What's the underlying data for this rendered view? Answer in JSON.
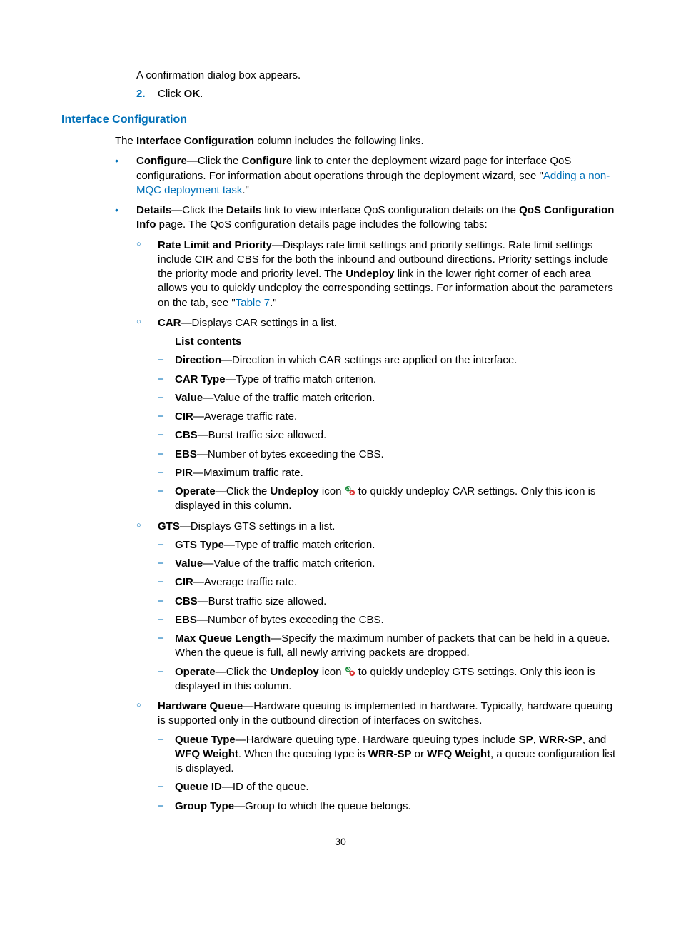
{
  "intro": {
    "confirm": "A confirmation dialog box appears.",
    "step2_prefix": "Click ",
    "step2_bold": "OK",
    "step2_suffix": "."
  },
  "heading": "Interface Configuration",
  "lead_prefix": "The ",
  "lead_bold": "Interface Configuration",
  "lead_suffix": " column includes the following links.",
  "configure": {
    "bold1": "Configure",
    "t1": "—Click the ",
    "bold2": "Configure",
    "t2": " link to enter the deployment wizard page for interface QoS configurations. For information about operations through the deployment wizard, see \"",
    "link": "Adding a non-MQC deployment task",
    "t3": ".\""
  },
  "details": {
    "bold1": "Details",
    "t1": "—Click the ",
    "bold2": "Details",
    "t2": " link to view interface QoS configuration details on the ",
    "bold3": "QoS Configuration Info",
    "t3": " page. The QoS configuration details page includes the following tabs:"
  },
  "rateLimit": {
    "bold": "Rate Limit and Priority",
    "t1": "—Displays rate limit settings and priority settings. Rate limit settings include CIR and CBS for the both the inbound and outbound directions. Priority settings include the priority mode and priority level. The ",
    "bold2": "Undeploy",
    "t2": " link in the lower right corner of each area allows you to quickly undeploy the corresponding settings. For information about the parameters on the tab, see \"",
    "link": "Table 7",
    "t3": ".\""
  },
  "car": {
    "bold": "CAR",
    "t": "—Displays CAR settings in a list.",
    "listHeading": "List contents",
    "items": {
      "direction": {
        "b": "Direction",
        "t": "—Direction in which CAR settings are applied on the interface."
      },
      "carType": {
        "b": "CAR Type",
        "t": "—Type of traffic match criterion."
      },
      "value": {
        "b": "Value",
        "t": "—Value of the traffic match criterion."
      },
      "cir": {
        "b": "CIR",
        "t": "—Average traffic rate."
      },
      "cbs": {
        "b": "CBS",
        "t": "—Burst traffic size allowed."
      },
      "ebs": {
        "b": "EBS",
        "t": "—Number of bytes exceeding the CBS."
      },
      "pir": {
        "b": "PIR",
        "t": "—Maximum traffic rate."
      },
      "operate": {
        "b": "Operate",
        "t1": "—Click the ",
        "b2": "Undeploy",
        "t2": " icon ",
        "t3": " to quickly undeploy CAR settings. Only this icon is displayed in this column."
      }
    }
  },
  "gts": {
    "bold": "GTS",
    "t": "—Displays GTS settings in a list.",
    "items": {
      "gtsType": {
        "b": "GTS Type",
        "t": "—Type of traffic match criterion."
      },
      "value": {
        "b": "Value",
        "t": "—Value of the traffic match criterion."
      },
      "cir": {
        "b": "CIR",
        "t": "—Average traffic rate."
      },
      "cbs": {
        "b": "CBS",
        "t": "—Burst traffic size allowed."
      },
      "ebs": {
        "b": "EBS",
        "t": "—Number of bytes exceeding the CBS."
      },
      "maxq": {
        "b": "Max Queue Length",
        "t": "—Specify the maximum number of packets that can be held in a queue. When the queue is full, all newly arriving packets are dropped."
      },
      "operate": {
        "b": "Operate",
        "t1": "—Click the ",
        "b2": "Undeploy",
        "t2": " icon ",
        "t3": " to quickly undeploy GTS settings. Only this icon is displayed in this column."
      }
    }
  },
  "hq": {
    "bold": "Hardware Queue",
    "t": "—Hardware queuing is implemented in hardware. Typically, hardware queuing is supported only in the outbound direction of interfaces on switches.",
    "items": {
      "qtype": {
        "b": "Queue Type",
        "t1": "—Hardware queuing type. Hardware queuing types include ",
        "b2": "SP",
        "t2": ", ",
        "b3": "WRR-SP",
        "t3": ", and ",
        "b4": "WFQ Weight",
        "t4": ". When the queuing type is ",
        "b5": "WRR-SP",
        "t5": " or ",
        "b6": "WFQ Weight",
        "t6": ", a queue configuration list is displayed."
      },
      "qid": {
        "b": "Queue ID",
        "t": "—ID of the queue."
      },
      "gtype": {
        "b": "Group Type",
        "t": "—Group to which the queue belongs."
      }
    }
  },
  "pageNumber": "30"
}
